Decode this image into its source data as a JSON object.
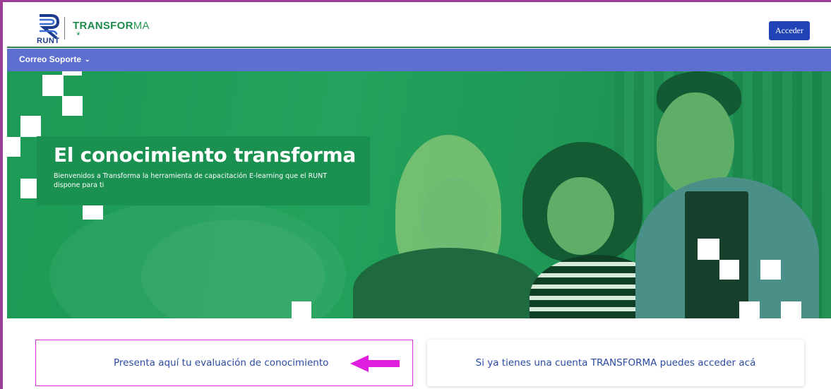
{
  "header": {
    "logo_runt": "RUNT",
    "logo_transforma_bold": "TRANSFOR",
    "logo_transforma_light": "MA",
    "login_button": "Acceder"
  },
  "navbar": {
    "menu_label": "Correo Soporte"
  },
  "hero": {
    "title": "El conocimiento transforma",
    "subtitle": "Bienvenidos a Transforma la herramienta de capacitación E-learning que el RUNT dispone para ti"
  },
  "cards": {
    "evaluation": "Presenta aquí tu evaluación de conocimiento",
    "existing_account": "Si ya tienes una cuenta TRANSFORMA puedes acceder acá"
  },
  "colors": {
    "brand_green": "#1a9150",
    "nav_blue": "#5d6fcf",
    "button_blue": "#2143b8",
    "highlight_magenta": "#d12dd4"
  }
}
